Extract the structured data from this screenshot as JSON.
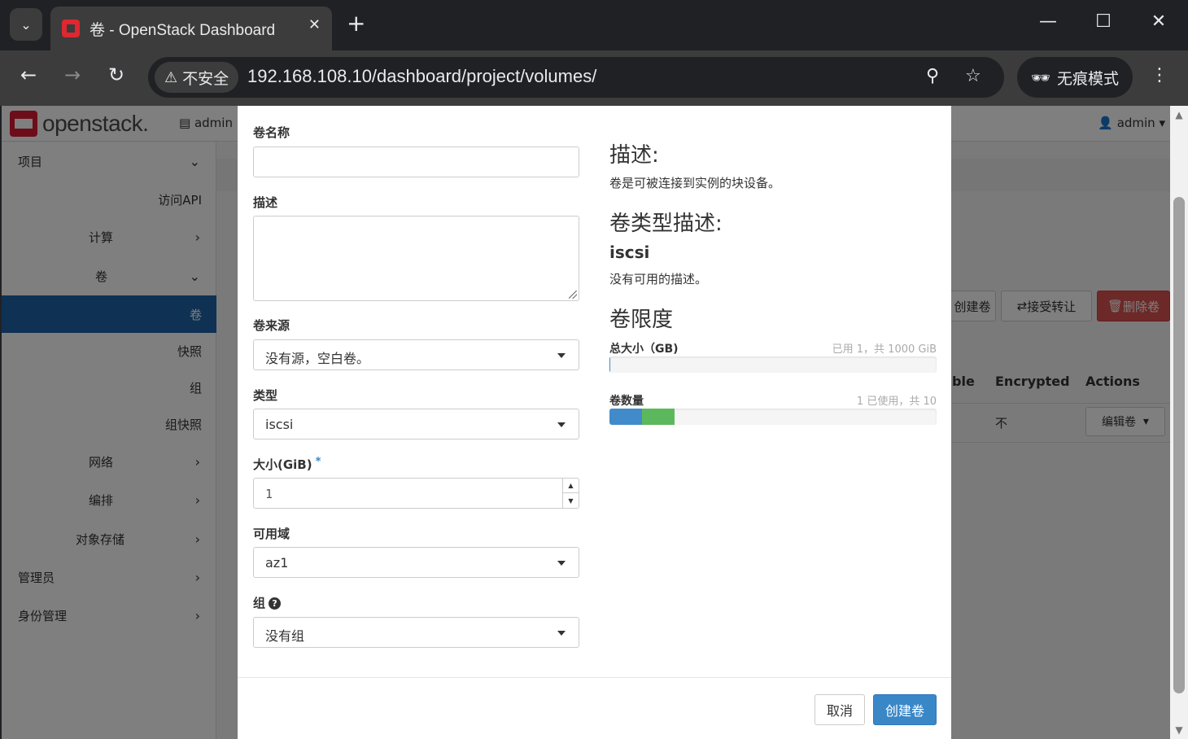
{
  "browser": {
    "tab_title": "卷 - OpenStack Dashboard",
    "url": "192.168.108.10/dashboard/project/volumes/",
    "security_label": "不安全",
    "incognito_label": "无痕模式"
  },
  "header": {
    "logo": "openstack.",
    "project": "admin",
    "user": "admin"
  },
  "sidebar": {
    "items": [
      {
        "label": "项目"
      },
      {
        "label": "访问API"
      },
      {
        "label": "计算"
      },
      {
        "label": "卷"
      },
      {
        "label": "卷"
      },
      {
        "label": "快照"
      },
      {
        "label": "组"
      },
      {
        "label": "组快照"
      },
      {
        "label": "网络"
      },
      {
        "label": "编排"
      },
      {
        "label": "对象存储"
      },
      {
        "label": "管理员"
      },
      {
        "label": "身份管理"
      }
    ]
  },
  "background": {
    "create_volume": "创建卷",
    "accept_transfer": "接受转让",
    "delete_volume": "删除卷",
    "col_bootable": "ble",
    "col_encrypted": "Encrypted",
    "col_actions": "Actions",
    "row_encrypted": "不",
    "row_action": "编辑卷"
  },
  "modal": {
    "name_label": "卷名称",
    "name_value": "",
    "desc_label": "描述",
    "desc_value": "",
    "source_label": "卷来源",
    "source_value": "没有源，空白卷。",
    "type_label": "类型",
    "type_value": "iscsi",
    "size_label": "大小(GiB)",
    "size_required": "*",
    "size_value": "1",
    "az_label": "可用域",
    "az_value": "az1",
    "group_label": "组",
    "group_value": "没有组",
    "desc_heading": "描述:",
    "desc_text": "卷是可被连接到实例的块设备。",
    "type_desc_heading": "卷类型描述:",
    "type_name": "iscsi",
    "type_desc_text": "没有可用的描述。",
    "limits_heading": "卷限度",
    "quota_size_label": "总大小（GB)",
    "quota_size_usage": "已用 1，共 1000 GiB",
    "quota_size_used_fraction": 0.001,
    "quota_count_label": "卷数量",
    "quota_count_usage": "1 已使用，共 10",
    "quota_count_used_fraction": 0.1,
    "quota_count_added_fraction": 0.1,
    "cancel_label": "取消",
    "submit_label": "创建卷"
  },
  "colors": {
    "primary": "#3a87c7",
    "danger": "#d9534f",
    "bar_used": "#428bca",
    "bar_new": "#5cb85c",
    "sidebar_active": "#1e63a6"
  }
}
